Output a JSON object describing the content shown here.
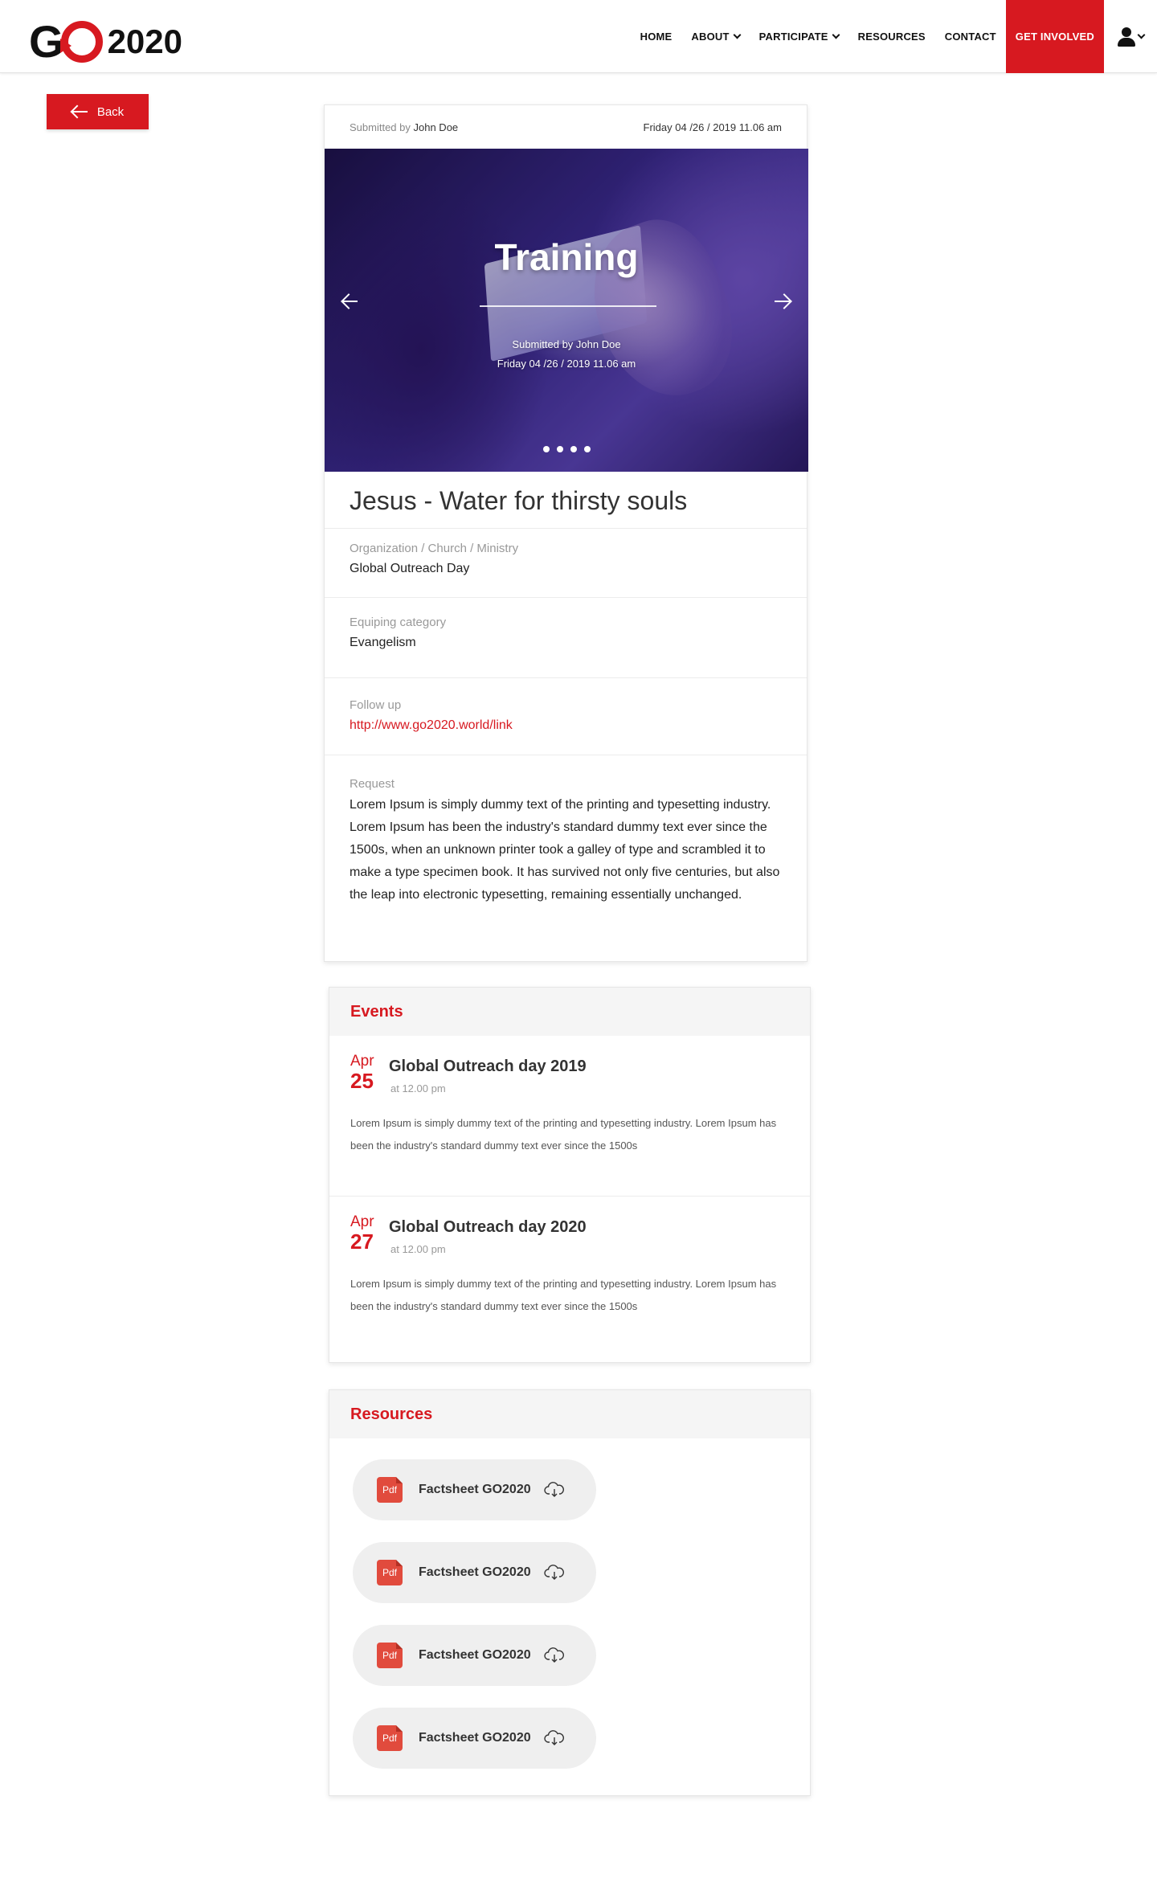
{
  "header": {
    "logo_letter": "G",
    "logo_year": "2020",
    "nav": [
      {
        "label": "HOME",
        "has_dropdown": false
      },
      {
        "label": "ABOUT",
        "has_dropdown": true
      },
      {
        "label": "PARTICIPATE",
        "has_dropdown": true
      },
      {
        "label": "RESOURCES",
        "has_dropdown": false
      },
      {
        "label": "CONTACT",
        "has_dropdown": false
      }
    ],
    "cta_label": "GET INVOLVED",
    "user_icon": "user-icon"
  },
  "back_label": "Back",
  "post": {
    "submitted_prefix": "Submitted by",
    "author": "John Doe",
    "date": "Friday 04 /26 / 2019 11.06 am",
    "hero": {
      "title": "Training",
      "submitted_line": "Submitted by John Doe",
      "date_line": "Friday 04 /26 / 2019 11.06 am",
      "dot_count": 4
    },
    "title": "Jesus - Water for thirsty souls",
    "fields": {
      "org_label": "Organization / Church / Ministry",
      "org_value": "Global Outreach Day",
      "category_label": "Equiping category",
      "category_value": "Evangelism",
      "followup_label": "Follow up",
      "followup_value": "http://www.go2020.world/link",
      "request_label": "Request",
      "request_value": "Lorem Ipsum is simply dummy text of the printing and typesetting industry. Lorem Ipsum has been the industry's standard dummy text ever since the 1500s, when an unknown printer took a galley of type and scrambled it to make a type specimen book. It has survived not only five centuries, but also the leap into electronic typesetting, remaining essentially unchanged."
    }
  },
  "events": {
    "heading": "Events",
    "items": [
      {
        "month": "Apr",
        "day": "25",
        "title": "Global Outreach day 2019",
        "time": "at 12.00 pm",
        "desc": "Lorem Ipsum is simply dummy text of the printing and typesetting industry. Lorem Ipsum has been the industry's standard dummy text ever since the 1500s"
      },
      {
        "month": "Apr",
        "day": "27",
        "title": "Global Outreach day 2020",
        "time": "at 12.00 pm",
        "desc": "Lorem Ipsum is simply dummy text of the printing and typesetting industry. Lorem Ipsum has been the industry's standard dummy text ever since the 1500s"
      }
    ]
  },
  "resources": {
    "heading": "Resources",
    "items": [
      {
        "badge": "Pdf",
        "name": "Factsheet GO2020",
        "icon": "cloud-download-icon"
      },
      {
        "badge": "Pdf",
        "name": "Factsheet GO2020",
        "icon": "cloud-download-icon"
      },
      {
        "badge": "Pdf",
        "name": "Factsheet GO2020",
        "icon": "cloud-download-icon"
      },
      {
        "badge": "Pdf",
        "name": "Factsheet GO2020",
        "icon": "cloud-download-icon"
      }
    ]
  },
  "colors": {
    "accent": "#d71920",
    "section_head_bg": "#f5f5f5",
    "pill_bg": "#efefef",
    "pdf_badge": "#e14b3d"
  }
}
